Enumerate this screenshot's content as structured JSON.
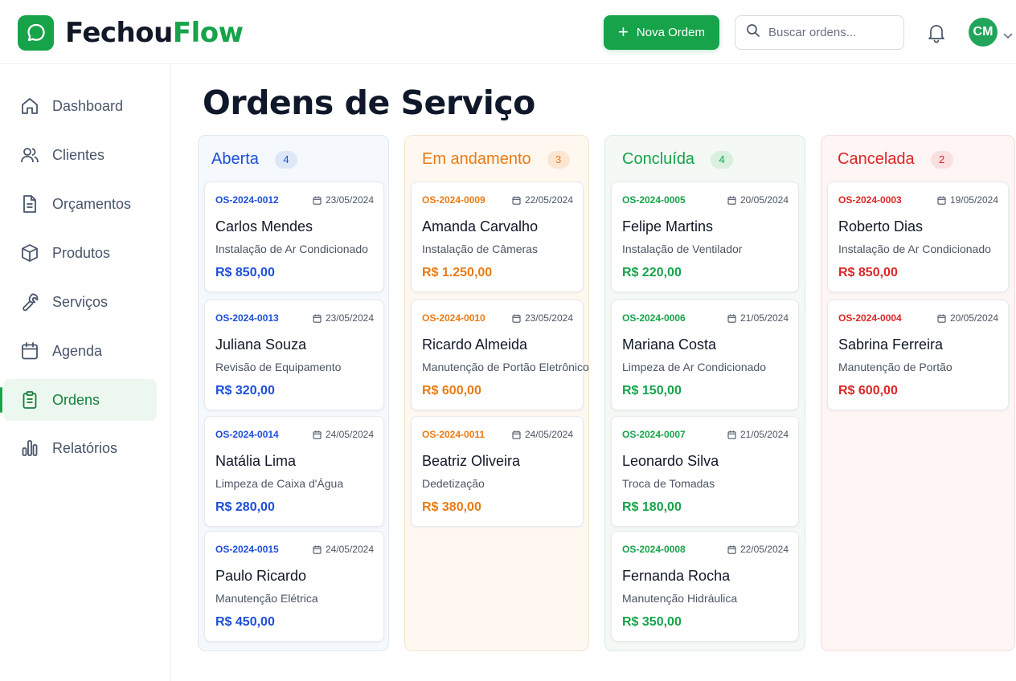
{
  "app": {
    "brand_part1": "Fechou",
    "brand_part2": "Flow"
  },
  "header": {
    "new_order_label": "Nova Ordem",
    "search_placeholder": "Buscar ordens...",
    "avatar_initials": "CM"
  },
  "sidebar": {
    "items": [
      {
        "label": "Dashboard",
        "icon": "home-icon"
      },
      {
        "label": "Clientes",
        "icon": "users-icon"
      },
      {
        "label": "Orçamentos",
        "icon": "file-icon"
      },
      {
        "label": "Produtos",
        "icon": "box-icon"
      },
      {
        "label": "Serviços",
        "icon": "wrench-icon"
      },
      {
        "label": "Agenda",
        "icon": "calendar-icon"
      },
      {
        "label": "Ordens",
        "icon": "clipboard-icon",
        "active": true
      },
      {
        "label": "Relatórios",
        "icon": "bar-chart-icon"
      }
    ]
  },
  "page": {
    "title": "Ordens de Serviço"
  },
  "colors": {
    "brand": "#16a34a",
    "aberta": "#1d4ed8",
    "em_andamento": "#ea7a12",
    "concluida": "#16a34a",
    "cancelada": "#dc2626"
  },
  "columns": [
    {
      "title": "Aberta",
      "count": "4",
      "cards": [
        {
          "code": "OS-2024-0012",
          "date": "23/05/2024",
          "client": "Carlos Mendes",
          "service": "Instalação de Ar Condicionado",
          "price": "R$ 850,00"
        },
        {
          "code": "OS-2024-0013",
          "date": "23/05/2024",
          "client": "Juliana Souza",
          "service": "Revisão de Equipamento",
          "price": "R$ 320,00"
        },
        {
          "code": "OS-2024-0014",
          "date": "24/05/2024",
          "client": "Natália Lima",
          "service": "Limpeza de Caixa d'Água",
          "price": "R$ 280,00"
        },
        {
          "code": "OS-2024-0015",
          "date": "24/05/2024",
          "client": "Paulo Ricardo",
          "service": "Manutenção Elétrica",
          "price": "R$ 450,00"
        }
      ]
    },
    {
      "title": "Em andamento",
      "count": "3",
      "cards": [
        {
          "code": "OS-2024-0009",
          "date": "22/05/2024",
          "client": "Amanda Carvalho",
          "service": "Instalação de Câmeras",
          "price": "R$ 1.250,00"
        },
        {
          "code": "OS-2024-0010",
          "date": "23/05/2024",
          "client": "Ricardo Almeida",
          "service": "Manutenção de Portão Eletrônico",
          "price": "R$ 600,00"
        },
        {
          "code": "OS-2024-0011",
          "date": "24/05/2024",
          "client": "Beatriz Oliveira",
          "service": "Dedetização",
          "price": "R$ 380,00"
        }
      ]
    },
    {
      "title": "Concluída",
      "count": "4",
      "cards": [
        {
          "code": "OS-2024-0005",
          "date": "20/05/2024",
          "client": "Felipe Martins",
          "service": "Instalação de Ventilador",
          "price": "R$ 220,00"
        },
        {
          "code": "OS-2024-0006",
          "date": "21/05/2024",
          "client": "Mariana Costa",
          "service": "Limpeza de Ar Condicionado",
          "price": "R$ 150,00"
        },
        {
          "code": "OS-2024-0007",
          "date": "21/05/2024",
          "client": "Leonardo Silva",
          "service": "Troca de Tomadas",
          "price": "R$ 180,00"
        },
        {
          "code": "OS-2024-0008",
          "date": "22/05/2024",
          "client": "Fernanda Rocha",
          "service": "Manutenção Hidráulica",
          "price": "R$ 350,00"
        }
      ]
    },
    {
      "title": "Cancelada",
      "count": "2",
      "cards": [
        {
          "code": "OS-2024-0003",
          "date": "19/05/2024",
          "client": "Roberto Dias",
          "service": "Instalação de Ar Condicionado",
          "price": "R$ 850,00"
        },
        {
          "code": "OS-2024-0004",
          "date": "20/05/2024",
          "client": "Sabrina Ferreira",
          "service": "Manutenção de Portão",
          "price": "R$ 600,00"
        }
      ]
    }
  ]
}
